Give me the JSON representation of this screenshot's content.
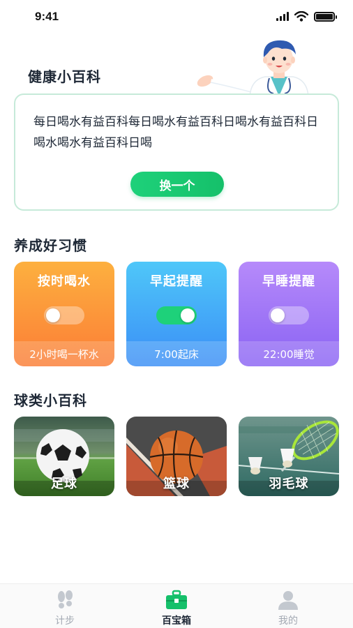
{
  "status_bar": {
    "time": "9:41",
    "signal_icon": "cellular-signal-icon",
    "wifi_icon": "wifi-icon",
    "battery_icon": "battery-icon"
  },
  "health_tips": {
    "title": "健康小百科",
    "illustration": "doctor-illustration",
    "tip_text": "每日喝水有益百科每日喝水有益百科日喝水有益百科日喝水喝水有益百科日喝",
    "change_button": "换一个"
  },
  "habits": {
    "title": "养成好习惯",
    "items": [
      {
        "title": "按时喝水",
        "footer": "2小时喝一杯水",
        "enabled": false,
        "color_top": "#fdb03f",
        "color_bottom": "#fb7d36"
      },
      {
        "title": "早起提醒",
        "footer": "7:00起床",
        "enabled": true,
        "color_top": "#4fc7f9",
        "color_bottom": "#3a8ef6"
      },
      {
        "title": "早睡提醒",
        "footer": "22:00睡觉",
        "enabled": false,
        "color_top": "#b68afa",
        "color_bottom": "#8a63f3"
      }
    ]
  },
  "ball_sports": {
    "title": "球类小百科",
    "items": [
      {
        "label": "足球",
        "image": "soccer-ball-photo"
      },
      {
        "label": "篮球",
        "image": "basketball-photo"
      },
      {
        "label": "羽毛球",
        "image": "badminton-photo"
      }
    ]
  },
  "tabbar": {
    "items": [
      {
        "label": "计步",
        "icon": "footprints-icon",
        "active": false
      },
      {
        "label": "百宝箱",
        "icon": "toolbox-icon",
        "active": true
      },
      {
        "label": "我的",
        "icon": "user-icon",
        "active": false
      }
    ],
    "active_color": "#15c06a",
    "inactive_color": "#c3c8cf"
  }
}
